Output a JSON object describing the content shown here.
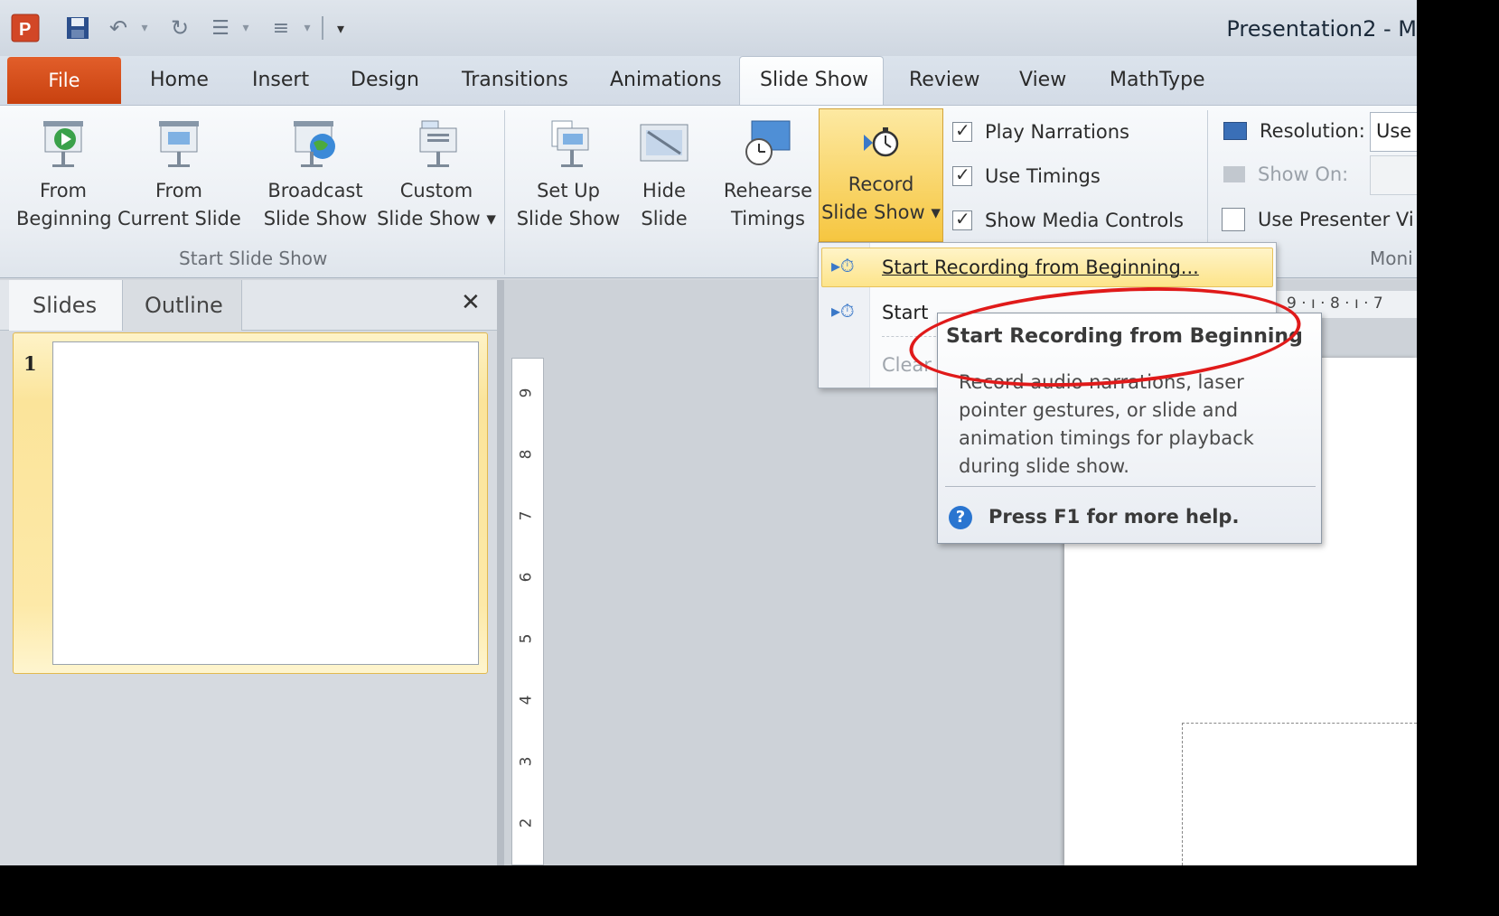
{
  "window": {
    "title": "Presentation2  -  M"
  },
  "ribbon_tabs": [
    "File",
    "Home",
    "Insert",
    "Design",
    "Transitions",
    "Animations",
    "Slide Show",
    "Review",
    "View",
    "MathType"
  ],
  "start_group": {
    "from_beginning": [
      "From",
      "Beginning"
    ],
    "from_current": [
      "From",
      "Current Slide"
    ],
    "broadcast": [
      "Broadcast",
      "Slide Show"
    ],
    "custom": [
      "Custom",
      "Slide Show ▾"
    ],
    "label": "Start Slide Show"
  },
  "setup_group": {
    "setup": [
      "Set Up",
      "Slide Show"
    ],
    "hide": [
      "Hide",
      "Slide"
    ],
    "rehearse": [
      "Rehearse",
      "Timings"
    ],
    "record": [
      "Record",
      "Slide Show ▾"
    ],
    "play_narrations": "Play Narrations",
    "use_timings": "Use Timings",
    "show_media": "Show Media Controls"
  },
  "monitors_group": {
    "resolution_label": "Resolution:",
    "resolution_value": "Use",
    "show_on_label": "Show On:",
    "presenter_view": "Use Presenter Vi",
    "label": "Moni"
  },
  "slides_pane": {
    "tab_slides": "Slides",
    "tab_outline": "Outline",
    "close": "✕",
    "slide_number": "1"
  },
  "ruler": {
    "vertical": [
      "9",
      "8",
      "7",
      "6",
      "5",
      "4",
      "3",
      "2"
    ],
    "horizontal_tail": "9 · ı · 8 · ı · 7"
  },
  "dropdown": {
    "item1": "Start Recording from Beginning...",
    "item2": "Start Recording from Current Slide...",
    "item3": "Clear"
  },
  "tooltip": {
    "title": "Start Recording from Beginning",
    "body": "Record audio narrations, laser pointer gestures, or slide and animation timings for playback during slide show.",
    "help": "Press F1 for more help."
  }
}
